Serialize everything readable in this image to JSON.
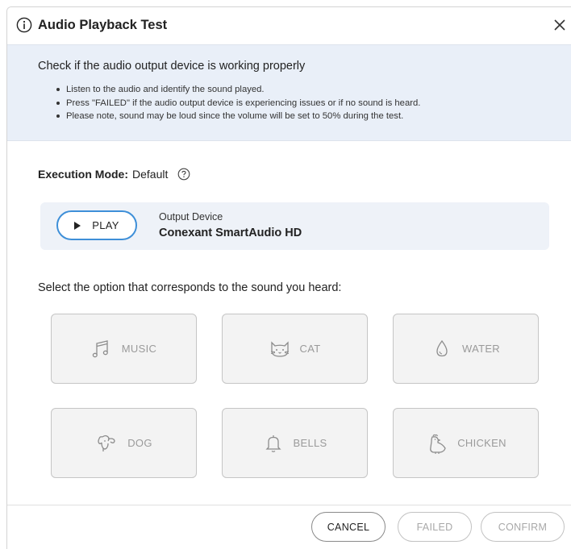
{
  "dialog": {
    "title": "Audio Playback Test"
  },
  "banner": {
    "heading": "Check if the audio output device is working properly",
    "bullets": [
      "Listen to the audio and identify the sound played.",
      "Press \"FAILED\" if the audio output device is experiencing issues or if no sound is heard.",
      "Please note, sound may be loud since the volume will be set to 50% during the test."
    ]
  },
  "execution": {
    "label": "Execution Mode:",
    "value": "Default"
  },
  "playback": {
    "play_label": "PLAY",
    "device_label": "Output Device",
    "device_name": "Conexant SmartAudio HD"
  },
  "prompt": "Select the option that corresponds to the sound you heard:",
  "options": [
    {
      "label": "MUSIC",
      "icon": "music-note-icon"
    },
    {
      "label": "CAT",
      "icon": "cat-icon"
    },
    {
      "label": "WATER",
      "icon": "water-drop-icon"
    },
    {
      "label": "DOG",
      "icon": "dog-icon"
    },
    {
      "label": "BELLS",
      "icon": "bell-icon"
    },
    {
      "label": "CHICKEN",
      "icon": "chicken-icon"
    }
  ],
  "footer": {
    "cancel_label": "CANCEL",
    "failed_label": "FAILED",
    "confirm_label": "CONFIRM"
  },
  "colors": {
    "accent": "#3e8fd8",
    "banner_bg": "#e9eff8",
    "disabled_text": "#9a9a9a"
  }
}
